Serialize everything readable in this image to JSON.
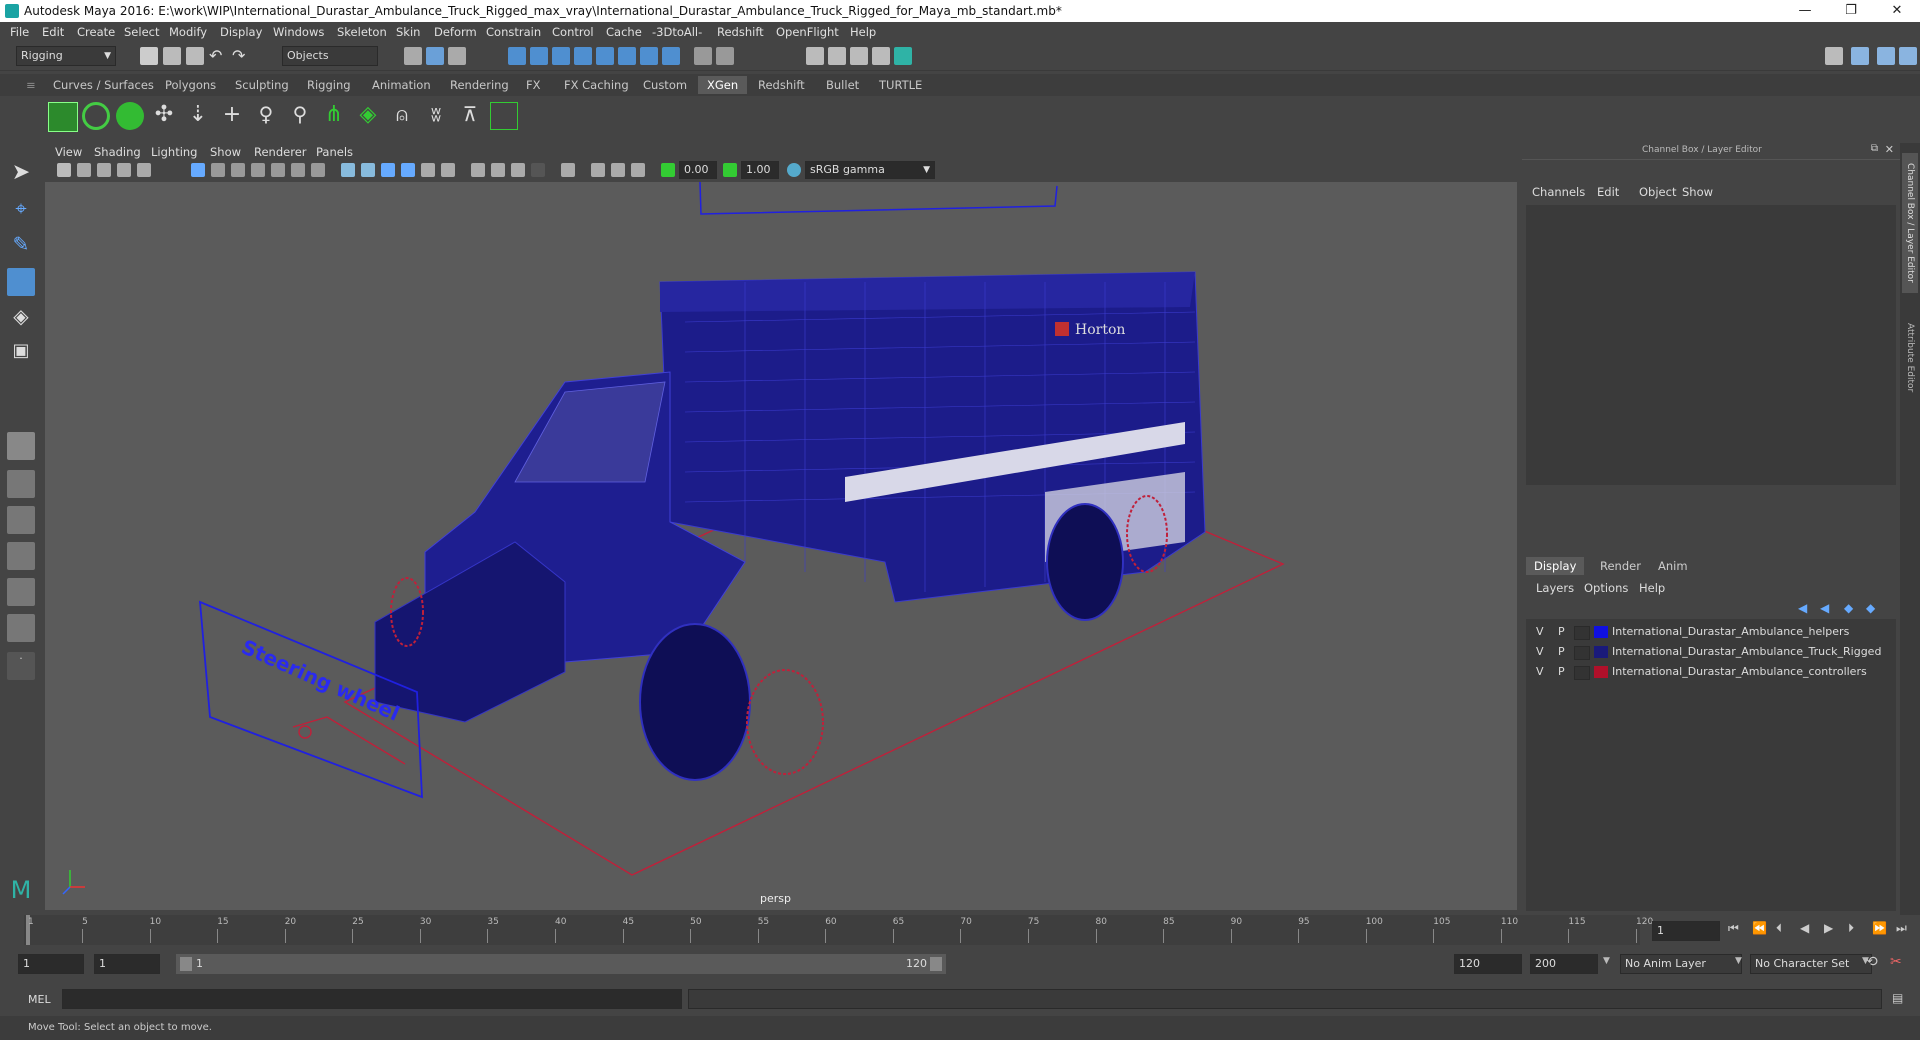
{
  "window": {
    "title": "Autodesk Maya 2016: E:\\work\\WIP\\International_Durastar_Ambulance_Truck_Rigged_max_vray\\International_Durastar_Ambulance_Truck_Rigged_for_Maya_mb_standart.mb*",
    "minimize": "—",
    "restore": "❐",
    "close": "✕"
  },
  "menu": [
    "File",
    "Edit",
    "Create",
    "Select",
    "Modify",
    "Display",
    "Windows",
    "Skeleton",
    "Skin",
    "Deform",
    "Constrain",
    "Control",
    "Cache",
    "-3DtoAll-",
    "Redshift",
    "OpenFlight",
    "Help"
  ],
  "statusline": {
    "menuset": "Rigging",
    "selection_mask": "Objects"
  },
  "shelf_tabs": [
    "Curves / Surfaces",
    "Polygons",
    "Sculpting",
    "Rigging",
    "Animation",
    "Rendering",
    "FX",
    "FX Caching",
    "Custom",
    "XGen",
    "Redshift",
    "Bullet",
    "TURTLE"
  ],
  "shelf_active_tab": "XGen",
  "viewport": {
    "menu": [
      "View",
      "Shading",
      "Lighting",
      "Show",
      "Renderer",
      "Panels"
    ],
    "exposure": "0.00",
    "gamma": "1.00",
    "color_space": "sRGB gamma",
    "camera_label": "persp",
    "steering_label": "Steering wheel",
    "truck_logo": "Horton"
  },
  "channel_box": {
    "title": "Channel Box / Layer Editor",
    "menu": [
      "Channels",
      "Edit",
      "Object",
      "Show"
    ],
    "layer_tabs": [
      "Display",
      "Render",
      "Anim"
    ],
    "layer_active_tab": "Display",
    "layer_menu": [
      "Layers",
      "Options",
      "Help"
    ],
    "layers": [
      {
        "v": "V",
        "p": "P",
        "color": "#1010e0",
        "name": "International_Durastar_Ambulance_helpers"
      },
      {
        "v": "V",
        "p": "P",
        "color": "#1a1a7a",
        "name": "International_Durastar_Ambulance_Truck_Rigged"
      },
      {
        "v": "V",
        "p": "P",
        "color": "#b0102a",
        "name": "International_Durastar_Ambulance_controllers"
      }
    ],
    "side_tabs": [
      "Channel Box / Layer Editor",
      "Attribute Editor"
    ]
  },
  "timeline": {
    "ticks": [
      "1",
      "5",
      "10",
      "15",
      "20",
      "25",
      "30",
      "35",
      "40",
      "45",
      "50",
      "55",
      "60",
      "65",
      "70",
      "75",
      "80",
      "85",
      "90",
      "95",
      "100",
      "105",
      "110",
      "115",
      "120"
    ],
    "current_frame": "1",
    "range_start": "1",
    "range_inner_start": "1",
    "range_slider_start": "1",
    "range_slider_end": "120",
    "range_end": "120",
    "anim_end": "200",
    "anim_layer": "No Anim Layer",
    "character_set": "No Character Set"
  },
  "command_line": {
    "label": "MEL"
  },
  "help_line": "Move Tool: Select an object to move."
}
